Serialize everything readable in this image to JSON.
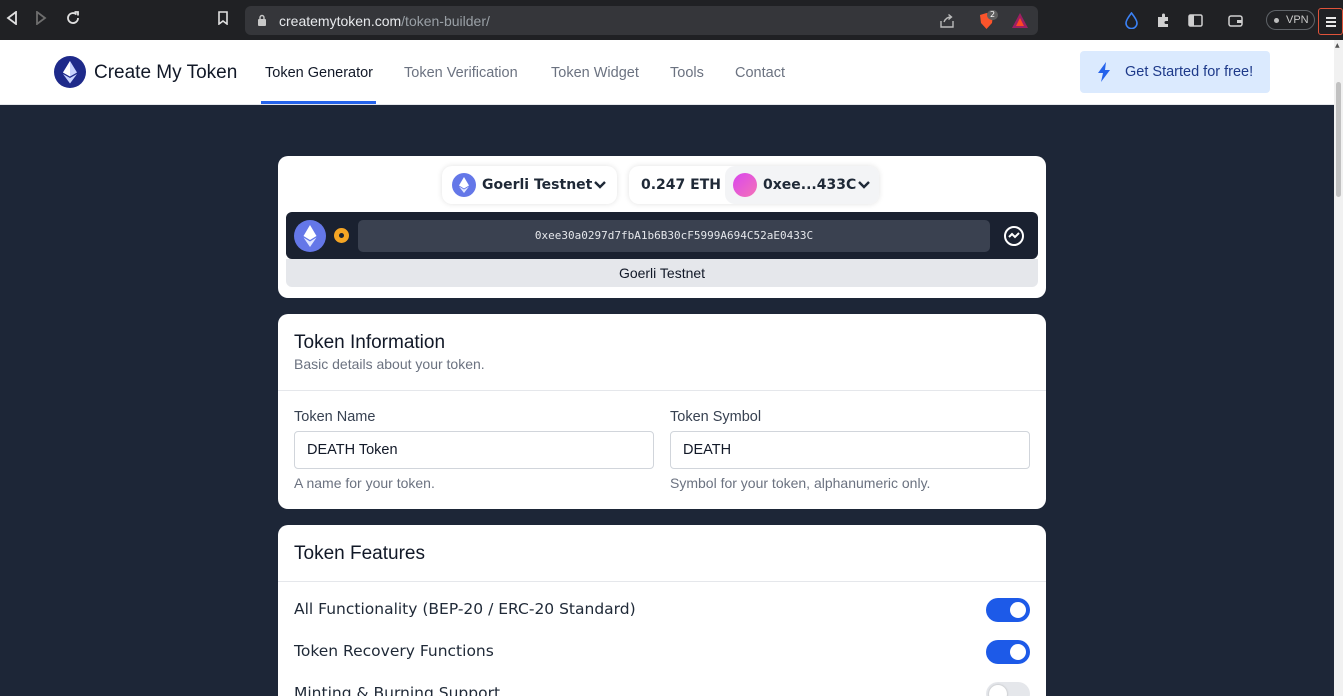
{
  "browser": {
    "url_host": "createmytoken.com",
    "url_path": "/token-builder/",
    "brave_badge": "2",
    "vpn_label": "VPN"
  },
  "header": {
    "brand": "Create My Token",
    "nav": [
      "Token Generator",
      "Token Verification",
      "Token Widget",
      "Tools",
      "Contact"
    ],
    "active_nav": "Token Generator",
    "cta": "Get Started for free!"
  },
  "wallet": {
    "network": "Goerli Testnet",
    "balance": "0.247 ETH",
    "account_short": "0xee...433C",
    "address": "0xee30a0297d7fbA1b6B30cF5999A694C52aE0433C",
    "network_footer": "Goerli Testnet"
  },
  "token_info": {
    "title": "Token Information",
    "subtitle": "Basic details about your token.",
    "name": {
      "label": "Token Name",
      "value": "DEATH Token",
      "help": "A name for your token."
    },
    "symbol": {
      "label": "Token Symbol",
      "value": "DEATH",
      "help": "Symbol for your token, alphanumeric only."
    }
  },
  "features": {
    "title": "Token Features",
    "items": [
      {
        "label": "All Functionality (BEP-20 / ERC-20 Standard)",
        "enabled": true
      },
      {
        "label": "Token Recovery Functions",
        "enabled": true
      },
      {
        "label": "Minting & Burning Support",
        "enabled": false
      }
    ]
  },
  "colors": {
    "page_bg": "#1d2637",
    "accent": "#1d5ae8",
    "cta_bg": "#dbeafe"
  }
}
